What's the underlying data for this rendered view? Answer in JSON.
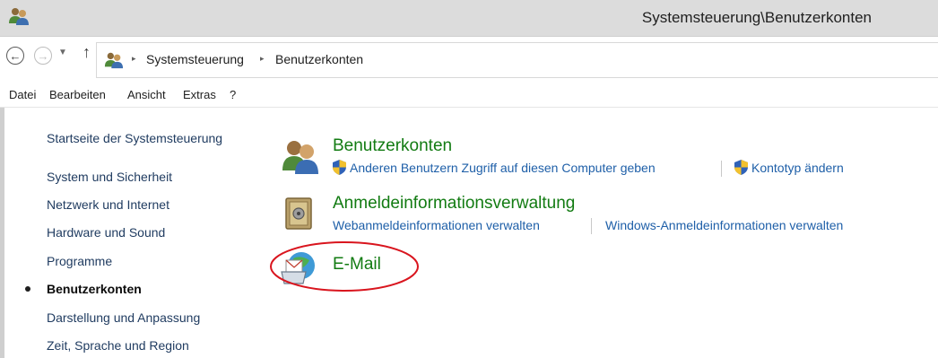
{
  "window": {
    "title": "Systemsteuerung\\Benutzerkonten"
  },
  "address_bar": {
    "breadcrumbs": [
      "Systemsteuerung",
      "Benutzerkonten"
    ],
    "separator": "▸"
  },
  "menu": {
    "items": [
      "Datei",
      "Bearbeiten",
      "Ansicht",
      "Extras",
      "?"
    ]
  },
  "sidebar": {
    "home_link": "Startseite der Systemsteuerung",
    "items": [
      "System und Sicherheit",
      "Netzwerk und Internet",
      "Hardware und Sound",
      "Programme",
      "Benutzerkonten",
      "Darstellung und Anpassung",
      "Zeit, Sprache und Region"
    ],
    "current_index": 4
  },
  "categories": [
    {
      "title": "Benutzerkonten",
      "icon": "users-icon",
      "links": [
        "Anderen Benutzern Zugriff auf diesen Computer geben",
        "Kontotyp ändern"
      ]
    },
    {
      "title": "Anmeldeinformationsverwaltung",
      "icon": "credential-vault-icon",
      "links": [
        "Webanmeldeinformationen verwalten",
        "Windows-Anmeldeinformationen verwalten"
      ]
    },
    {
      "title": "E-Mail",
      "icon": "mail-icon",
      "links": []
    }
  ],
  "colors": {
    "category_title": "#127b12",
    "link": "#1e5fa8",
    "highlight": "#d9151e"
  }
}
